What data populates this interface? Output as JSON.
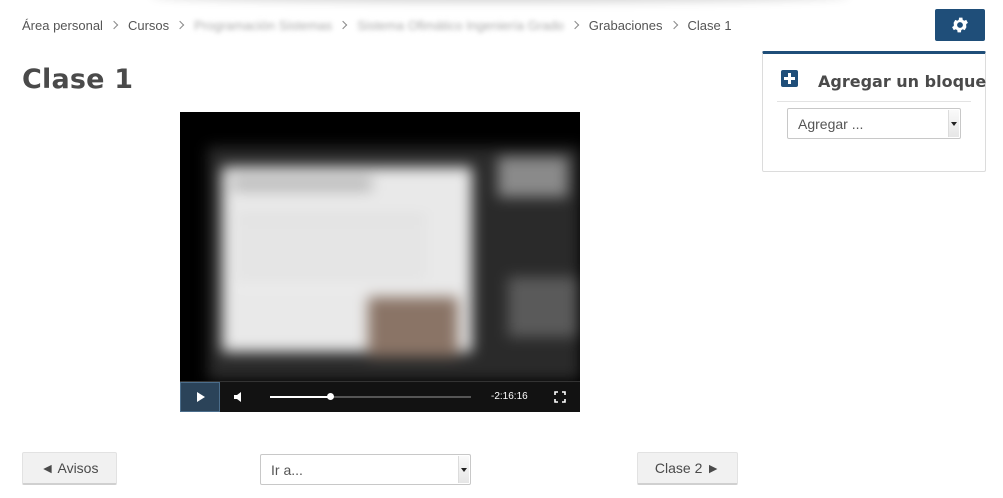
{
  "breadcrumb": {
    "items": [
      {
        "label": "Área personal"
      },
      {
        "label": "Cursos"
      },
      {
        "label": "Programación Sistemas"
      },
      {
        "label": "Sistema Ofimático Ingeniería Grado"
      },
      {
        "label": "Grabaciones"
      },
      {
        "label": "Clase 1"
      }
    ]
  },
  "page": {
    "title": "Clase 1"
  },
  "block_panel": {
    "title": "Agregar un bloque",
    "select_value": "Agregar ..."
  },
  "video": {
    "time_remaining": "-2:16:16",
    "progress_fraction": 0.3
  },
  "navigation": {
    "prev_label": "◄ Avisos",
    "jump_value": "Ir a...",
    "next_label": "Clase 2 ►"
  },
  "colors": {
    "accent": "#1f4e79"
  },
  "icons": {
    "settings": "gear-icon",
    "add_block": "plus-square-icon",
    "play": "play-icon",
    "mute": "volume-icon",
    "fullscreen": "fullscreen-icon"
  }
}
